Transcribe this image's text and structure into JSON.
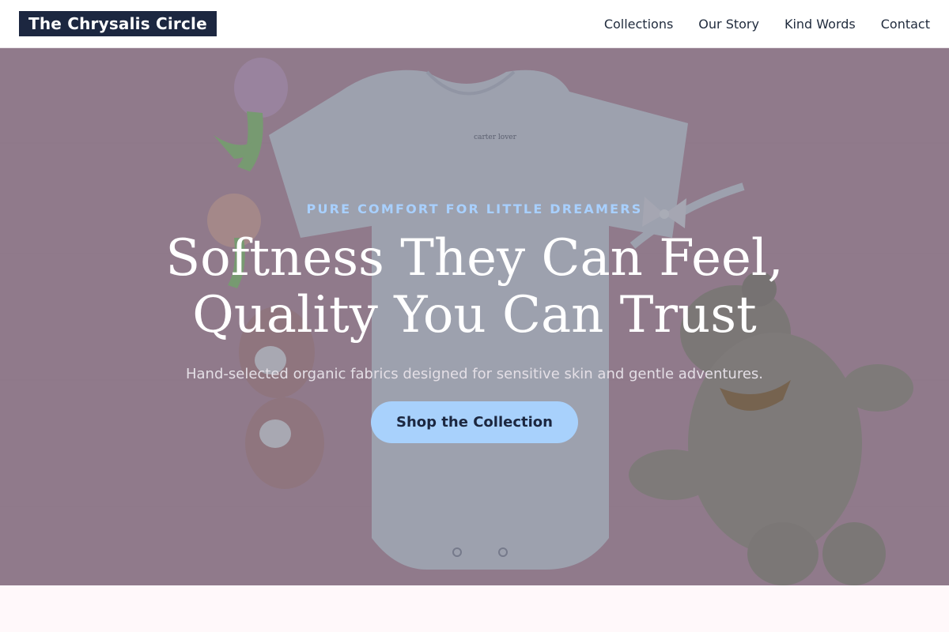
{
  "header": {
    "brand": "The Chrysalis Circle",
    "nav": [
      "Collections",
      "Our Story",
      "Kind Words",
      "Contact"
    ]
  },
  "hero": {
    "eyebrow": "PURE COMFORT FOR LITTLE DREAMERS",
    "headline_line1": "Softness They Can Feel,",
    "headline_line2": "Quality You Can Trust",
    "subtext": "Hand-selected organic fabrics designed for sensitive skin and gentle adventures.",
    "cta_label": "Shop the Collection",
    "onesie_tag": "carter lover"
  },
  "colors": {
    "brand_bg": "#1c2740",
    "accent": "#a8d1fc",
    "hero_pink": "#c39aa7"
  }
}
